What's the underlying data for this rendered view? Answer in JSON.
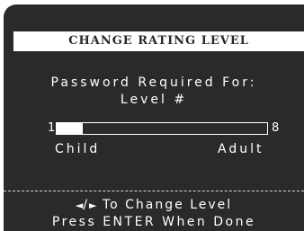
{
  "dialog": {
    "title": "CHANGE RATING LEVEL",
    "prompt_line1": "Password Required For:",
    "prompt_line2": "Level #"
  },
  "rating_slider": {
    "min_label": "1",
    "max_label": "8",
    "current_level": 1,
    "min_level": 1,
    "max_level": 8,
    "left_caption": "Child",
    "right_caption": "Adult"
  },
  "help": {
    "left_arrow_icon": "left-triangle-icon",
    "right_arrow_icon": "right-triangle-icon",
    "left_arrow_glyph": "◄",
    "separator": "/",
    "right_arrow_glyph": "►",
    "change_text": " To Change Level",
    "done_text": "Press ENTER When Done"
  },
  "colors": {
    "background": "#2a2a2a",
    "foreground": "#ffffff"
  }
}
